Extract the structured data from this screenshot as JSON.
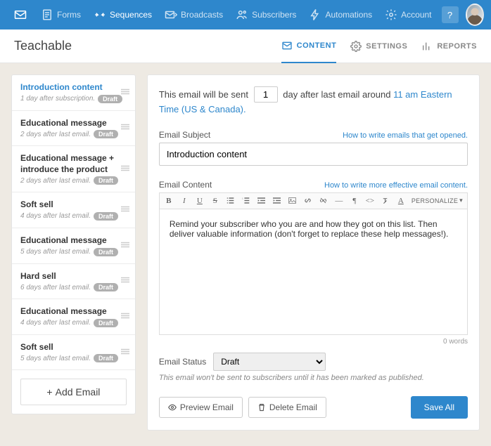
{
  "nav": {
    "items": [
      {
        "label": "Forms"
      },
      {
        "label": "Sequences"
      },
      {
        "label": "Broadcasts"
      },
      {
        "label": "Subscribers"
      },
      {
        "label": "Automations"
      },
      {
        "label": "Account"
      }
    ],
    "help": "?"
  },
  "pageTitle": "Teachable",
  "tabs": {
    "content": "CONTENT",
    "settings": "SETTINGS",
    "reports": "REPORTS"
  },
  "steps": [
    {
      "title": "Introduction content",
      "sub": "1 day after subscription.",
      "badge": "Draft",
      "active": true
    },
    {
      "title": "Educational message",
      "sub": "2 days after last email.",
      "badge": "Draft"
    },
    {
      "title": "Educational message + introduce the product",
      "sub": "2 days after last email.",
      "badge": "Draft"
    },
    {
      "title": "Soft sell",
      "sub": "4 days after last email.",
      "badge": "Draft"
    },
    {
      "title": "Educational message",
      "sub": "5 days after last email.",
      "badge": "Draft"
    },
    {
      "title": "Hard sell",
      "sub": "6 days after last email.",
      "badge": "Draft"
    },
    {
      "title": "Educational message",
      "sub": "4 days after last email.",
      "badge": "Draft"
    },
    {
      "title": "Soft sell",
      "sub": "5 days after last email.",
      "badge": "Draft"
    }
  ],
  "addEmail": "Add Email",
  "schedule": {
    "prefix": "This email will be sent",
    "value": "1",
    "mid": "day after last email around",
    "linkText": "11 am Eastern Time (US & Canada).",
    "suffix": ""
  },
  "subject": {
    "label": "Email Subject",
    "hint": "How to write emails that get opened.",
    "value": "Introduction content"
  },
  "contentField": {
    "label": "Email Content",
    "hint": "How to write more effective email content."
  },
  "editor": {
    "body": "Remind your subscriber who you are and how they got on this list. Then deliver valuable information (don't forget to replace these help messages!).",
    "wordCount": "0 words",
    "personalize": "PERSONALIZE"
  },
  "status": {
    "label": "Email Status",
    "value": "Draft",
    "hint": "This email won't be sent to subscribers until it has been marked as published."
  },
  "buttons": {
    "preview": "Preview Email",
    "delete": "Delete Email",
    "save": "Save All"
  }
}
